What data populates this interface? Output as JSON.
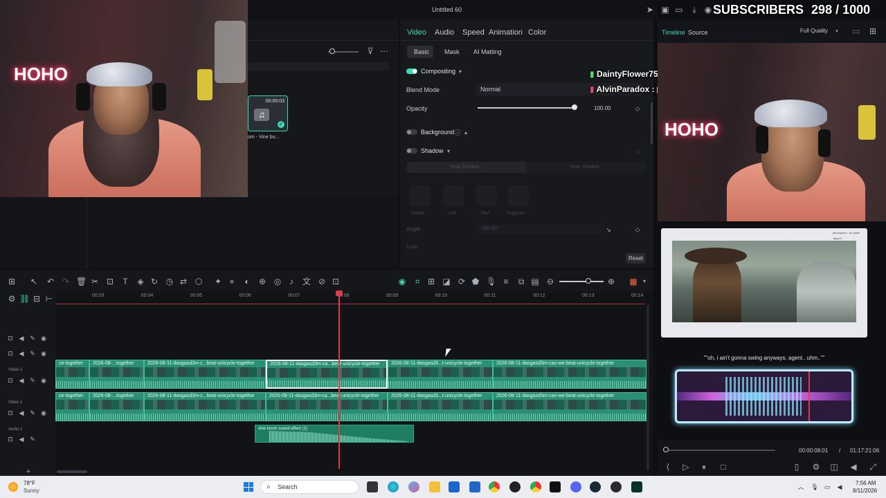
{
  "overlay": {
    "subscribers_label": "SUBSCRIBERS",
    "subscribers_count": "298 / 1000",
    "chat": [
      {
        "user": "DaintyFlower753 :",
        "color": "#f2d54b"
      },
      {
        "user": "AlvinParadox :",
        "color": "#f5a8c6"
      }
    ],
    "cam_text_left": "HOHO",
    "cam_text_right": "HOHO",
    "quote": "\"\"oh, i ain't gonna swing anyways, agent.. uhm..\"\"",
    "video_caption_top": "Jayy24 :",
    "video_caption_top2": "jamanjones : do apide"
  },
  "window": {
    "title": "Untitled 60"
  },
  "media": {
    "clip_time": "00:00:03",
    "clip_name": "om - Vine bo..."
  },
  "properties": {
    "tabs": [
      "Video",
      "Audio",
      "Speed",
      "Animation",
      "Color"
    ],
    "active_tab": "Video",
    "subtabs": [
      "Basic",
      "Mask",
      "AI Matting"
    ],
    "compositing_label": "Compositing",
    "blend_mode_label": "Blend Mode",
    "blend_mode_value": "Normal",
    "opacity_label": "Opacity",
    "opacity_value": "100.00",
    "opacity_fraction": 1.0,
    "background_label": "Background",
    "shadow_label": "Shadow",
    "shadow_tabs": [
      "Drop Shadow",
      "Inner Shadow"
    ],
    "shadow_presets": [
      "Default",
      "Soft",
      "Tiled",
      "Projection"
    ],
    "angle_label": "Angle",
    "angle_value": "135.00°",
    "color_label": "Color",
    "reset_label": "Reset"
  },
  "preview": {
    "tabs": [
      "Timeline",
      "Source"
    ],
    "quality": "Full Quality",
    "current_time": "00:00:08:01",
    "separator": "/",
    "total_time": "01:17:21:06",
    "progress_fraction": 0.0
  },
  "timeline": {
    "ruler": [
      "00:03",
      "00:04",
      "00:05",
      "00:06",
      "00:07",
      "00:08",
      "00:09",
      "00:10",
      "00:11",
      "00:12",
      "00:13",
      "00:14"
    ],
    "tracks": [
      "Video 2",
      "Video 1",
      "Audio 1"
    ],
    "video2_clips": [
      "ce-together",
      "2026-08-...together",
      "2026-08-11-dasgasd3m-c...beat-unicycle-together",
      "2026-08-11-dasgasd3m-ca...beat-unicycle-together",
      "2026-08-11-dasgasd3...t-unicycle-together",
      "2026-08-11-dasgasd3m-can-we-beat-unicycle-together"
    ],
    "video1_clips": [
      "ce-together",
      "2026-08-...together",
      "2026-08-11-dasgasd3m-c...beat-unicycle-together",
      "2026-08-11-dasgasd3m-ca...beat-unicycle-together",
      "2026-08-11-dasgasd3...t-unicycle-together",
      "2026-08-11-dasgasd3m-can-we-beat-unicycle-together"
    ],
    "audio_clip": "vine boom sound effect (1)"
  },
  "taskbar": {
    "weather_temp": "78°F",
    "weather_desc": "Sunny",
    "search_label": "Search",
    "time": "7:56 AM",
    "date": "8/11/2026"
  }
}
